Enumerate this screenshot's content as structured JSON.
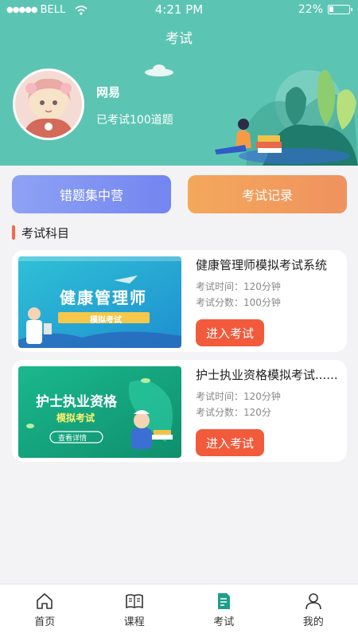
{
  "status_bar": {
    "carrier": "BELL",
    "time": "4:21 PM",
    "battery": "22%",
    "battery_level": 0.22
  },
  "header": {
    "title": "考试",
    "username": "网易",
    "subtitle": "已考试100道题"
  },
  "actions": {
    "wrong_questions": "错题集中营",
    "exam_records": "考试记录"
  },
  "section": {
    "title": "考试科目"
  },
  "exams": [
    {
      "title": "健康管理师模拟考试系统",
      "time": "考试时间：120分钟",
      "score": "考试分数：100分钟",
      "button": "进入考试",
      "thumb_title": "健康管理师",
      "thumb_sub": "模拟考试"
    },
    {
      "title": "护士执业资格模拟考试......",
      "time": "考试时间：120分钟",
      "score": "考试分数：120分",
      "button": "进入考试",
      "thumb_title": "护士执业资格",
      "thumb_sub": "模拟考试",
      "thumb_btn": "查看详情"
    }
  ],
  "tabbar": [
    {
      "label": "首页",
      "icon": "home-icon"
    },
    {
      "label": "课程",
      "icon": "book-icon"
    },
    {
      "label": "考试",
      "icon": "exam-icon"
    },
    {
      "label": "我的",
      "icon": "user-icon"
    }
  ],
  "colors": {
    "header": "#5cc4b3",
    "accent": "#f25a3c",
    "active_tab": "#1e9e8a"
  }
}
